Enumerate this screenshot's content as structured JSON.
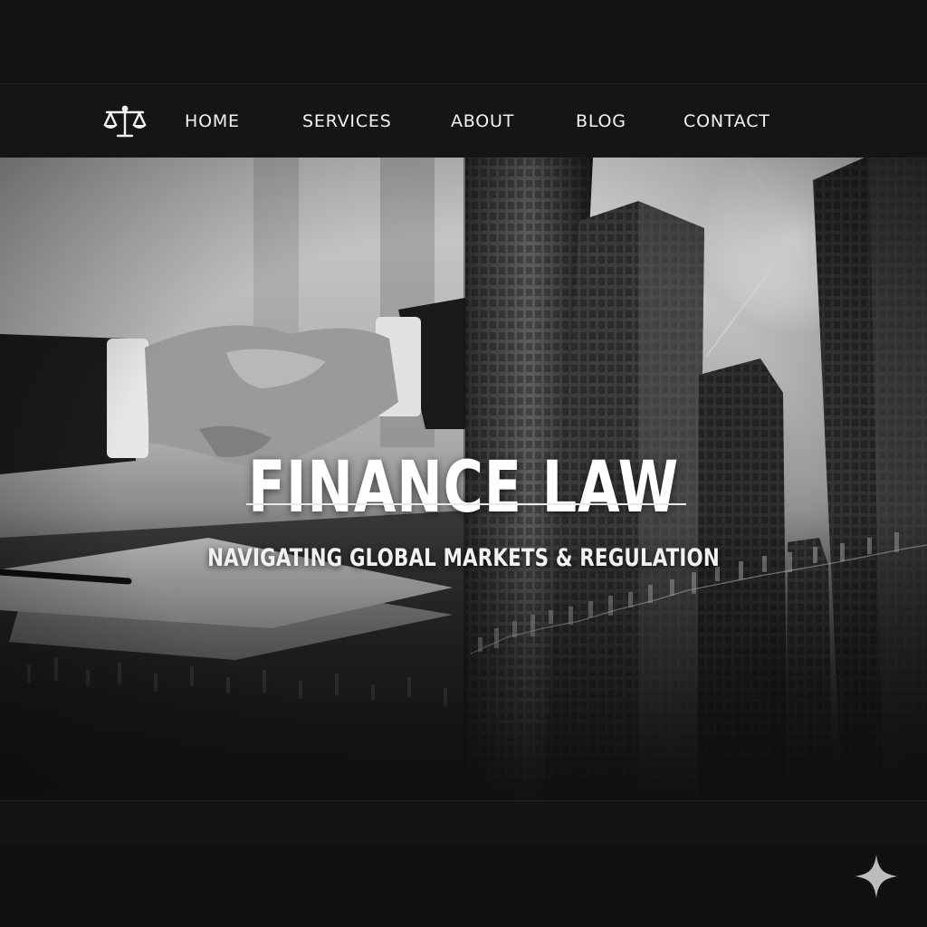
{
  "nav": {
    "logo_icon": "scales-of-justice-icon",
    "items": [
      {
        "label": "HOME"
      },
      {
        "label": "SERVICES"
      },
      {
        "label": "ABOUT"
      },
      {
        "label": "BLOG"
      },
      {
        "label": "CONTACT"
      }
    ]
  },
  "hero": {
    "title": "FINANCE LAW",
    "subtitle": "NAVIGATING GLOBAL MARKETS & REGULATION",
    "left_image": "handshake-over-documents",
    "right_image": "skyscrapers-with-stock-chart-overlay"
  },
  "corner": {
    "icon": "sparkle-icon"
  },
  "colors": {
    "background": "#111214",
    "nav_bg": "#141517",
    "text": "#f2f2f2"
  }
}
